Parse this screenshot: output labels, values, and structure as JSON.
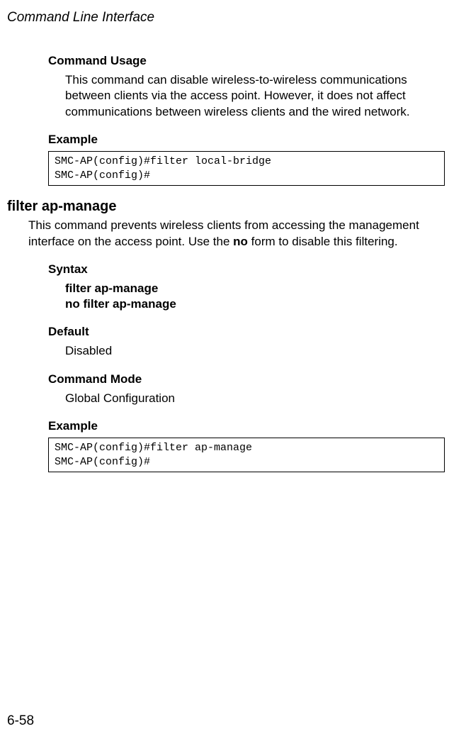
{
  "running_head": "Command Line Interface",
  "page_number": "6-58",
  "sec1": {
    "usage_h": "Command Usage",
    "usage_body": "This command can disable wireless-to-wireless communications between clients via the access point. However, it does not affect communications between wireless clients and the wired network.",
    "example_h": "Example",
    "code1": "SMC-AP(config)#filter local-bridge\nSMC-AP(config)#"
  },
  "sec2": {
    "title": "filter ap-manage",
    "intro_pre": "This command prevents wireless clients from accessing the management interface on the access point. Use the ",
    "intro_bold": "no",
    "intro_post": " form to disable this filtering.",
    "syntax_h": "Syntax",
    "syntax_line1": "filter ap-manage",
    "syntax_line2": "no filter ap-manage",
    "default_h": "Default",
    "default_val": "Disabled",
    "mode_h": "Command Mode",
    "mode_val": "Global Configuration",
    "example_h": "Example",
    "code2": "SMC-AP(config)#filter ap-manage\nSMC-AP(config)#"
  }
}
